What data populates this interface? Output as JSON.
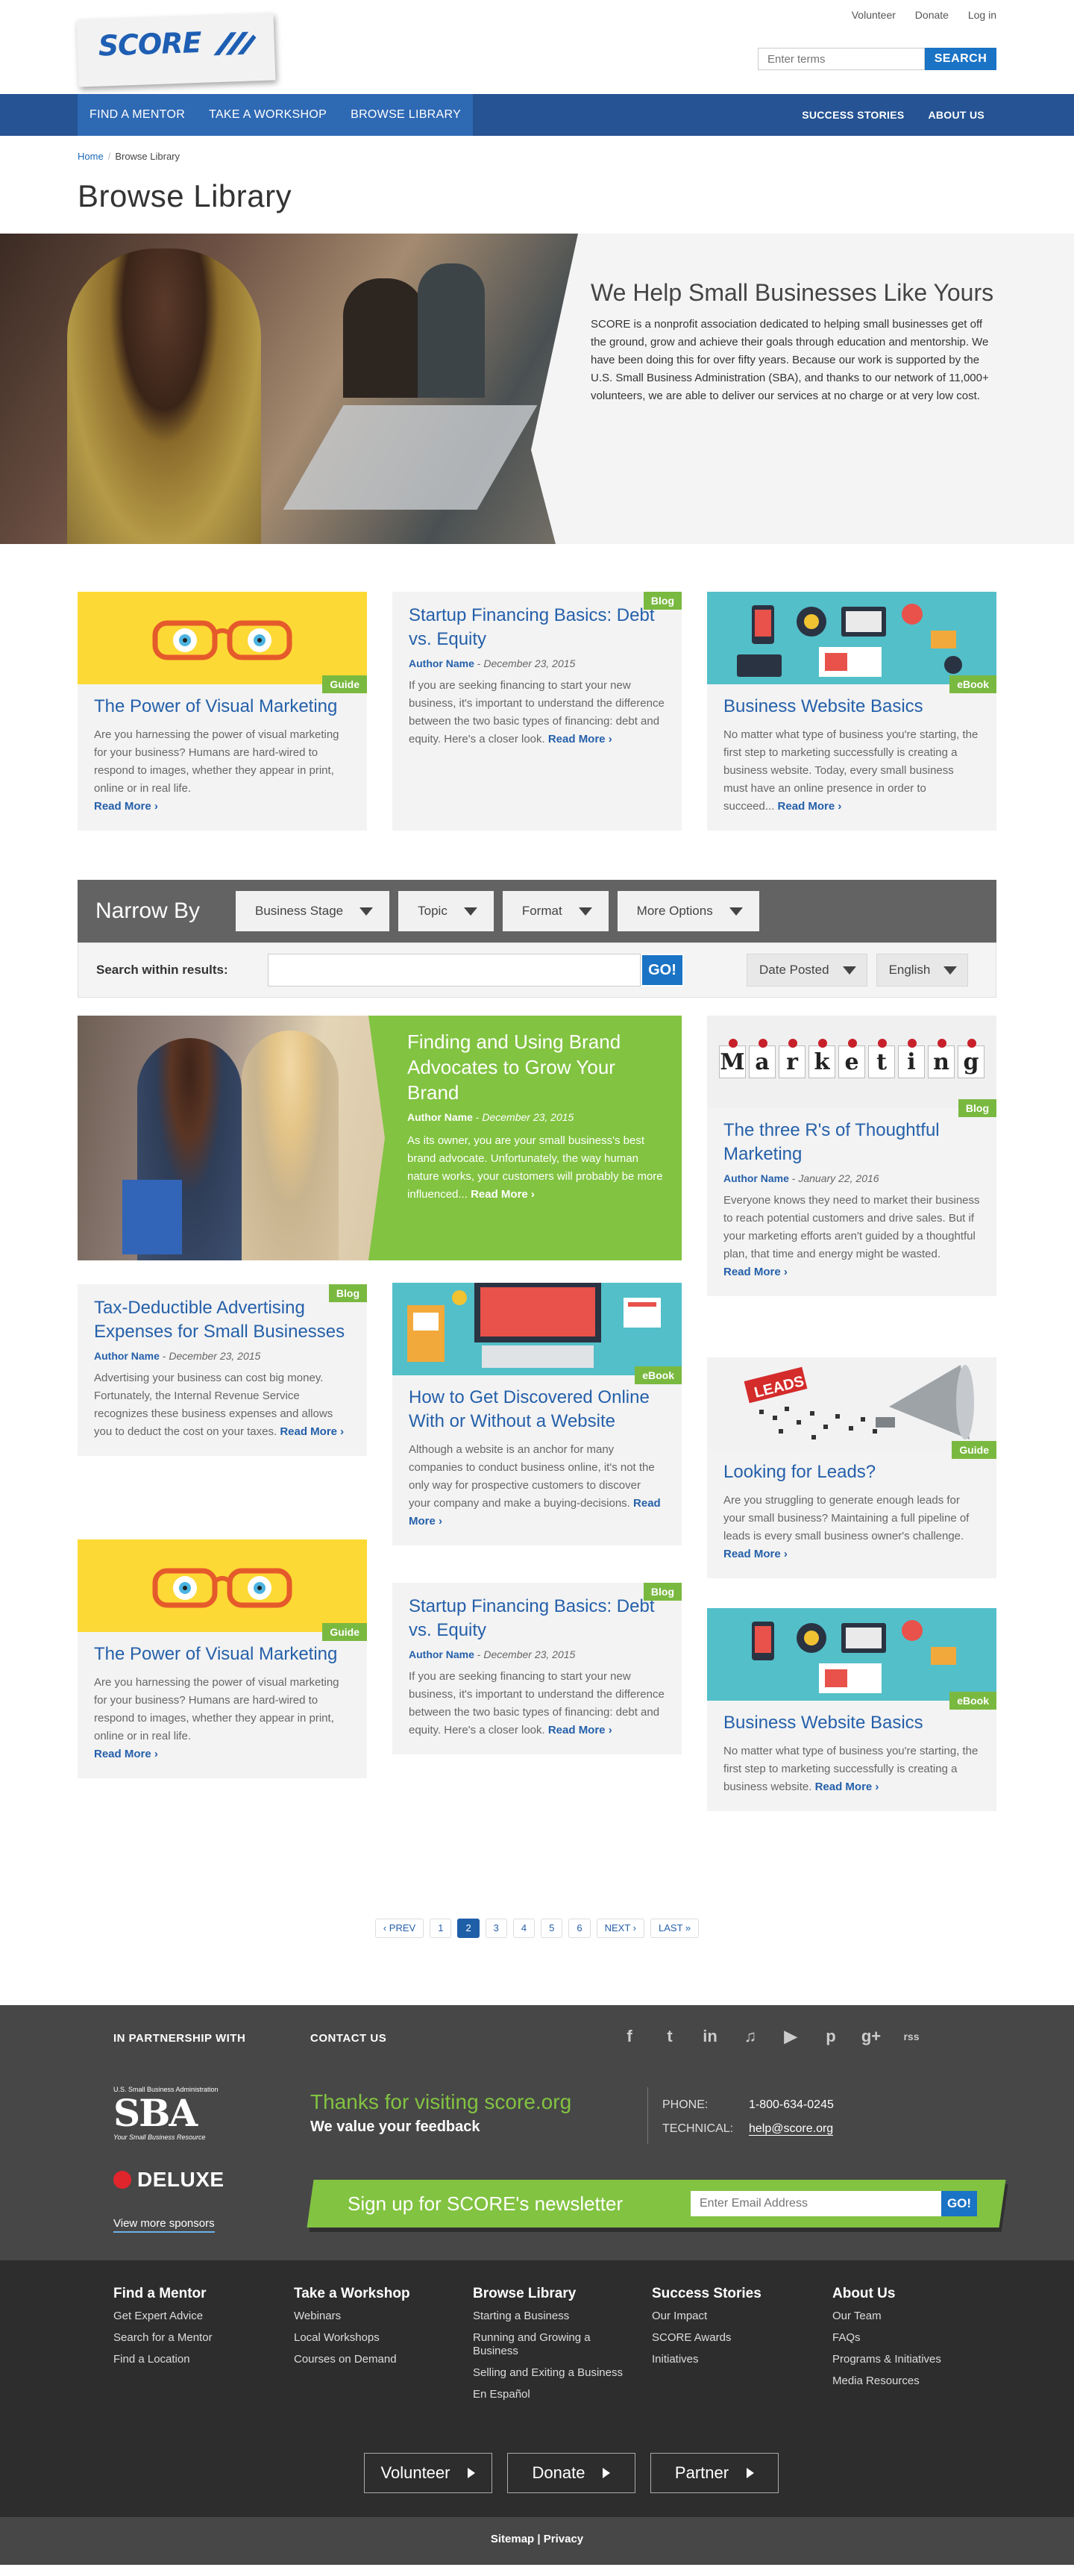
{
  "header": {
    "logo_text": "SCORE",
    "util_links": [
      "Volunteer",
      "Donate",
      "Log in"
    ],
    "search_placeholder": "Enter terms",
    "search_button": "SEARCH"
  },
  "nav": {
    "left": [
      "FIND A MENTOR",
      "TAKE A WORKSHOP",
      "BROWSE LIBRARY"
    ],
    "right": [
      "SUCCESS STORIES",
      "ABOUT US"
    ]
  },
  "breadcrumb": {
    "home": "Home",
    "sep": "/",
    "current": "Browse Library"
  },
  "page_title": "Browse Library",
  "hero": {
    "title": "We Help Small Businesses Like Yours",
    "text": "SCORE is a nonprofit association dedicated to helping small businesses get off the ground, grow and achieve their goals through education and mentorship. We have been doing this for over fifty years. Because our work is supported by the U.S. Small Business Administration (SBA), and thanks to our network of 11,000+ volunteers, we are able to deliver our services at no charge or at very low cost."
  },
  "cards_top": [
    {
      "tag": "Guide",
      "title": "The Power of Visual Marketing",
      "desc": "Are you harnessing the power of visual marketing for your business? Humans are hard-wired to respond to images, whether they appear in print, online or in real life.",
      "read_more": "Read More ›"
    },
    {
      "tag": "Blog",
      "title": "Startup Financing Basics: Debt vs. Equity",
      "author": "Author Name",
      "date": "December 23, 2015",
      "desc": "If you are seeking financing to start your new business, it's important to understand the difference between the two basic types of financing: debt and equity. Here's a closer look.",
      "read_more": "Read More ›"
    },
    {
      "tag": "eBook",
      "title": "Business Website Basics",
      "desc": "No matter what type of business you're starting, the first step to marketing successfully is creating a business website. Today, every small business must have an online presence in order to succeed...",
      "read_more": "Read More ›"
    }
  ],
  "narrow": {
    "label": "Narrow By",
    "filters": [
      "Business Stage",
      "Topic",
      "Format",
      "More Options"
    ],
    "search_label": "Search within results:",
    "go": "GO!",
    "sort": "Date Posted",
    "language": "English"
  },
  "featured": {
    "title": "Finding and Using Brand Advocates to Grow Your Brand",
    "author": "Author Name",
    "date": "December 23, 2015",
    "desc": "As its owner, you are your small business's best brand advocate. Unfortunately, the way human nature works, your customers will probably be more influenced...",
    "read_more": "Read More ›"
  },
  "marketing_letters": [
    "M",
    "a",
    "r",
    "k",
    "e",
    "t",
    "i",
    "n",
    "g"
  ],
  "leads_label": "LEADS",
  "masonry": {
    "three_rs": {
      "tag": "Blog",
      "title": "The three R's of Thoughtful Marketing",
      "author": "Author Name",
      "date": "January 22, 2016",
      "desc": "Everyone knows they need to market their business to reach potential customers and drive sales. But if your marketing efforts aren't guided by a thoughtful plan, that time and energy might be wasted.",
      "read_more": "Read More ›"
    },
    "tax": {
      "tag": "Blog",
      "title": "Tax-Deductible Advertising Expenses for Small Businesses",
      "author": "Author Name",
      "date": "December 23, 2015",
      "desc": "Advertising your business can cost big money. Fortunately, the Internal Revenue Service recognizes these business expenses and allows you to deduct the cost on your taxes.",
      "read_more": "Read More ›"
    },
    "discovered": {
      "tag": "eBook",
      "title": "How to Get Discovered Online With or Without a Website",
      "desc": "Although a website is an anchor for many companies to conduct business online, it's not the only way for prospective customers to discover your company and make a buying-decisions.",
      "read_more": "Read More ›"
    },
    "leads": {
      "tag": "Guide",
      "title": "Looking for Leads?",
      "desc": "Are you struggling to generate enough leads for your small business? Maintaining a full pipeline of leads is every small business owner's challenge.",
      "read_more": "Read More ›"
    },
    "visual2": {
      "tag": "Guide",
      "title": "The Power of Visual Marketing",
      "desc": "Are you harnessing the power of visual marketing for your business? Humans are hard-wired to respond to images, whether they appear in print, online or in real life.",
      "read_more": "Read More ›"
    },
    "startup2": {
      "tag": "Blog",
      "title": "Startup Financing Basics: Debt vs. Equity",
      "author": "Author Name",
      "date": "December 23, 2015",
      "desc": "If you are seeking financing to start your new business, it's important to understand the difference between the two basic types of financing: debt and equity. Here's a closer look.",
      "read_more": "Read More ›"
    },
    "website2": {
      "tag": "eBook",
      "title": "Business Website Basics",
      "desc": "No matter what type of business you're starting, the first step to marketing successfully is creating a business website.",
      "read_more": "Read More ›"
    }
  },
  "pager": {
    "prev": "‹ PREV",
    "pages": [
      "1",
      "2",
      "3",
      "4",
      "5",
      "6"
    ],
    "current": "2",
    "next": "NEXT ›",
    "last": "LAST »"
  },
  "footer": {
    "partnership": "IN PARTNERSHIP WITH",
    "contact_us": "CONTACT US",
    "sba_small": "U.S. Small Business Administration",
    "sba_big": "SBA",
    "sba_sub": "Your Small Business Resource",
    "deluxe": "DELUXE",
    "view_sponsors": "View more sponsors",
    "thanks": "Thanks for visiting score.org",
    "value": "We value your feedback",
    "phone_label": "PHONE:",
    "phone": "1-800-634-0245",
    "tech_label": "TECHNICAL:",
    "email": "help@score.org",
    "newsletter": "Sign up for SCORE's newsletter",
    "email_placeholder": "Enter Email Address",
    "go": "GO!",
    "social": [
      "f",
      "t",
      "in",
      "♫",
      "▶",
      "p",
      "g+",
      "rss"
    ],
    "cols": [
      {
        "title": "Find a Mentor",
        "items": [
          "Get Expert Advice",
          "Search for a Mentor",
          "Find a Location"
        ]
      },
      {
        "title": "Take a Workshop",
        "items": [
          "Webinars",
          "Local Workshops",
          "Courses on Demand"
        ]
      },
      {
        "title": "Browse Library",
        "items": [
          "Starting a Business",
          "Running and Growing a Business",
          "Selling and Exiting a Business",
          "En Español"
        ]
      },
      {
        "title": "Success Stories",
        "items": [
          "Our Impact",
          "SCORE Awards",
          "Initiatives"
        ]
      },
      {
        "title": "About Us",
        "items": [
          "Our Team",
          "FAQs",
          "Programs & Initiatives",
          "Media Resources"
        ]
      }
    ],
    "buttons": [
      "Volunteer",
      "Donate",
      "Partner"
    ],
    "bottom": "Sitemap | Privacy"
  },
  "colors": {
    "brand_blue": "#255393",
    "accent_green": "#82c341",
    "link_blue": "#2560aa"
  }
}
